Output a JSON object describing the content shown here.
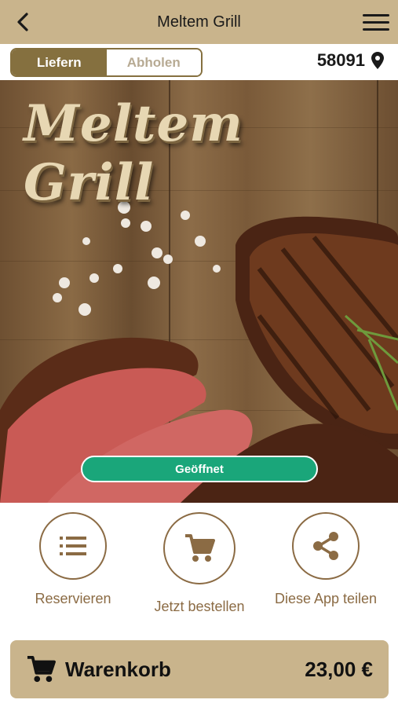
{
  "header": {
    "title": "Meltem Grill",
    "back_icon": "chevron-left-icon",
    "menu_icon": "hamburger-menu-icon"
  },
  "order_mode": {
    "options": [
      "Liefern",
      "Abholen"
    ],
    "selected": "Liefern"
  },
  "location": {
    "zip": "58091",
    "icon": "location-pin-icon"
  },
  "hero": {
    "logo_text": "Meltem Grill",
    "status": "Geöffnet"
  },
  "actions": [
    {
      "label": "Reservieren",
      "icon": "list-icon"
    },
    {
      "label": "Jetzt bestellen",
      "icon": "shopping-cart-icon"
    },
    {
      "label": "Diese App teilen",
      "icon": "share-icon"
    }
  ],
  "cart": {
    "label": "Warenkorb",
    "total": "23,00 €",
    "icon": "shopping-cart-icon"
  },
  "colors": {
    "header_bg": "#c9b48c",
    "accent": "#85703f",
    "status_green": "#1aa67a",
    "action_brown": "#8b6b44"
  }
}
